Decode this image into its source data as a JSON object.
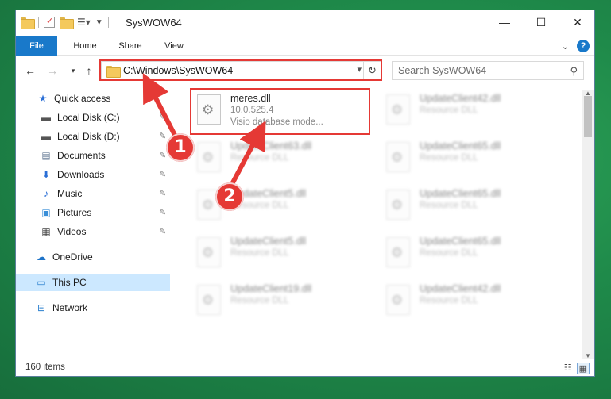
{
  "window": {
    "title": "SysWOW64",
    "minimize": "—",
    "maximize": "☐",
    "close": "✕"
  },
  "ribbon": {
    "tabs": [
      {
        "label": "File"
      },
      {
        "label": "Home"
      },
      {
        "label": "Share"
      },
      {
        "label": "View"
      }
    ]
  },
  "navbar": {
    "address": "C:\\Windows\\SysWOW64",
    "search_placeholder": "Search SysWOW64"
  },
  "sidebar": {
    "items": [
      {
        "label": "Quick access",
        "icon": "star-icon"
      },
      {
        "label": "Local Disk (C:)",
        "icon": "drive-icon"
      },
      {
        "label": "Local Disk (D:)",
        "icon": "drive-icon"
      },
      {
        "label": "Documents",
        "icon": "documents-icon"
      },
      {
        "label": "Downloads",
        "icon": "downloads-icon"
      },
      {
        "label": "Music",
        "icon": "music-icon"
      },
      {
        "label": "Pictures",
        "icon": "pictures-icon"
      },
      {
        "label": "Videos",
        "icon": "videos-icon"
      },
      {
        "label": "OneDrive",
        "icon": "cloud-icon"
      },
      {
        "label": "This PC",
        "icon": "computer-icon"
      },
      {
        "label": "Network",
        "icon": "network-icon"
      }
    ]
  },
  "files": [
    {
      "name": "meres.dll",
      "version": "10.0.525.4",
      "description": "Visio database mode..."
    },
    {
      "name": "UpdateClient42.dll",
      "description": "Resource DLL"
    },
    {
      "name": "UpdateClient63.dll",
      "description": "Resource DLL"
    },
    {
      "name": "UpdateClient65.dll",
      "description": "Resource DLL"
    },
    {
      "name": "UpdateClient5.dll",
      "description": "Resource DLL"
    },
    {
      "name": "UpdateClient65.dll",
      "description": "Resource DLL"
    },
    {
      "name": "UpdateClient5.dll",
      "description": "Resource DLL"
    },
    {
      "name": "UpdateClient65.dll",
      "description": "Resource DLL"
    },
    {
      "name": "UpdateClient19.dll",
      "description": "Resource DLL"
    },
    {
      "name": "UpdateClient42.dll",
      "description": "Resource DLL"
    }
  ],
  "status": {
    "item_count": "160 items"
  },
  "annotations": {
    "badge1": "1",
    "badge2": "2",
    "color": "#e53935"
  }
}
